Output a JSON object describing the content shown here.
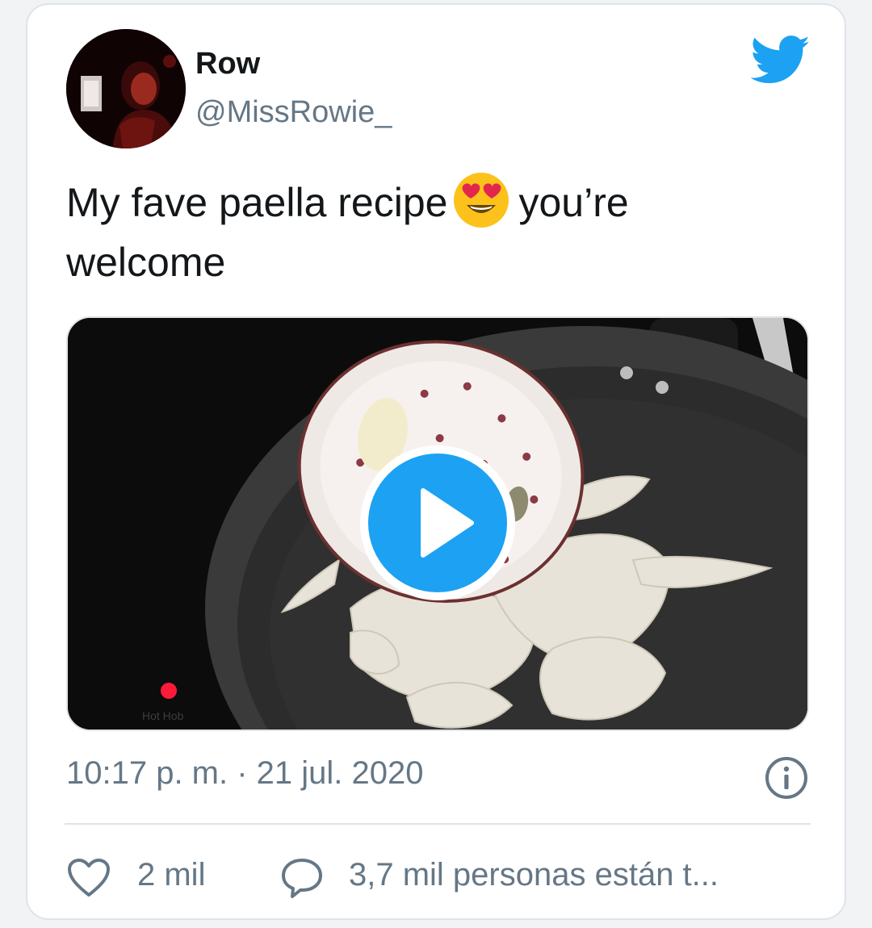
{
  "tweet": {
    "author_name": "Row",
    "author_handle": "@MissRowie_",
    "text_part1": "My fave paella recipe",
    "text_emoji": "smiling-face-with-heart-eyes",
    "text_part2": "you’re welcome",
    "timestamp": "10:17 p. m. · 21 jul. 2020",
    "likes": "2 mil",
    "conversation": "3,7 mil personas están t...",
    "media_type": "video",
    "media_watermark": "Hot Hob"
  },
  "colors": {
    "twitter_blue": "#1da1f2",
    "text_primary": "#14171a",
    "text_secondary": "#657786",
    "border": "#dfe4e8"
  },
  "icons": {
    "brand": "twitter-bird-icon",
    "play": "play-icon",
    "info": "info-icon",
    "like": "heart-icon",
    "reply": "speech-bubble-icon"
  }
}
